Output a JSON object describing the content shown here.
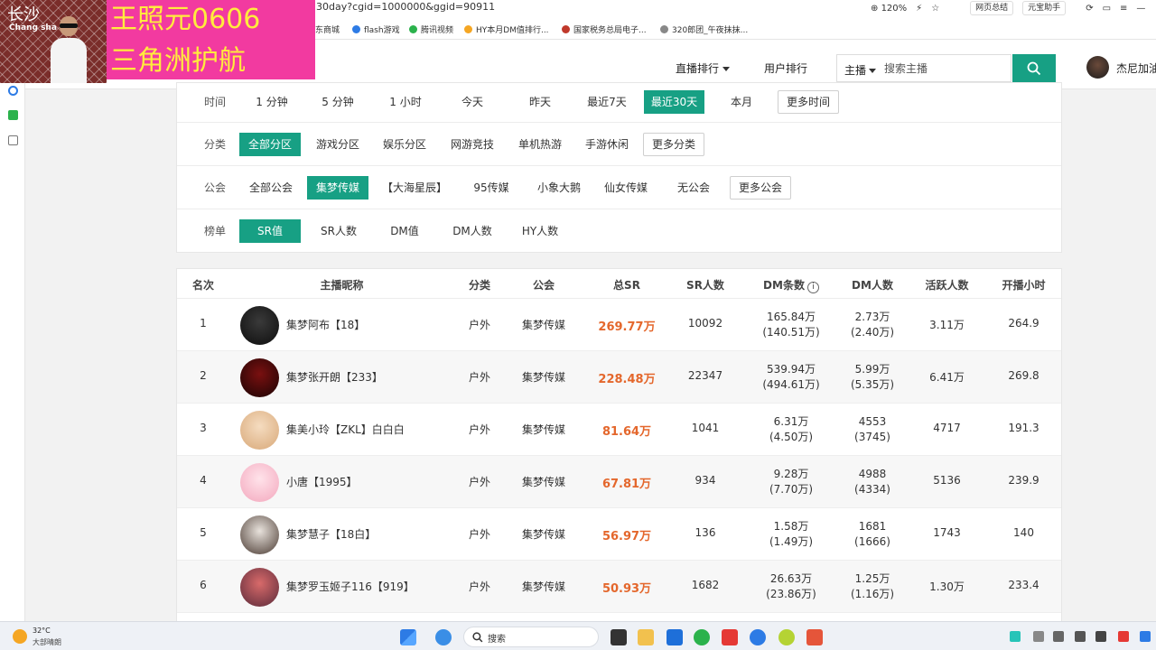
{
  "browser": {
    "url": "30day?cgid=1000000&ggid=90911",
    "zoom": "120%",
    "chips": [
      "网页总结",
      "元宝助手"
    ],
    "bookmarks": [
      "东商城",
      "flash游戏",
      "腾讯视频",
      "HY本月DM值排行...",
      "国家税务总局电子...",
      "320郎团_午夜抹抹..."
    ]
  },
  "overlay": {
    "cam_city": "长沙",
    "cam_sub": "Chang sha",
    "banner_line1": "王照元0606",
    "banner_line2": "三角洲护航"
  },
  "header": {
    "nav": [
      {
        "label": "直播排行",
        "active": true
      },
      {
        "label": "用户排行",
        "active": false
      }
    ],
    "search_type": "主播",
    "search_placeholder": "搜索主播",
    "user_name": "杰尼加油"
  },
  "filters": {
    "time": {
      "label": "时间",
      "options": [
        "1 分钟",
        "5 分钟",
        "1 小时",
        "今天",
        "昨天",
        "最近7天",
        "最近30天",
        "本月"
      ],
      "active": 6,
      "more": "更多时间"
    },
    "category": {
      "label": "分类",
      "options": [
        "全部分区",
        "游戏分区",
        "娱乐分区",
        "网游竞技",
        "单机热游",
        "手游休闲"
      ],
      "active": 0,
      "more": "更多分类"
    },
    "guild": {
      "label": "公会",
      "options": [
        "全部公会",
        "集梦传媒",
        "【大海星辰】",
        "95传媒",
        "小象大鹅",
        "仙女传媒",
        "无公会"
      ],
      "active": 1,
      "more": "更多公会"
    },
    "board": {
      "label": "榜单",
      "options": [
        "SR值",
        "SR人数",
        "DM值",
        "DM人数",
        "HY人数"
      ],
      "active": 0
    }
  },
  "table": {
    "headers": {
      "rank": "名次",
      "nickname": "主播昵称",
      "category": "分类",
      "guild": "公会",
      "total_sr": "总SR",
      "sr_people": "SR人数",
      "dm_count": "DM条数",
      "dm_people": "DM人数",
      "active_people": "活跃人数",
      "hours": "开播小时"
    },
    "rows": [
      {
        "rank": "1",
        "name": "集梦阿布【18】",
        "category": "户外",
        "guild": "集梦传媒",
        "total_sr": "269.77万",
        "sr_people": "10092",
        "dm_count": "165.84万",
        "dm_count_sub": "(140.51万)",
        "dm_people": "2.73万",
        "dm_people_sub": "(2.40万)",
        "active": "3.11万",
        "hours": "264.9",
        "avatar_colors": [
          "#3a3a3a",
          "#0d0d0d"
        ]
      },
      {
        "rank": "2",
        "name": "集梦张开朗【233】",
        "category": "户外",
        "guild": "集梦传媒",
        "total_sr": "228.48万",
        "sr_people": "22347",
        "dm_count": "539.94万",
        "dm_count_sub": "(494.61万)",
        "dm_people": "5.99万",
        "dm_people_sub": "(5.35万)",
        "active": "6.41万",
        "hours": "269.8",
        "avatar_colors": [
          "#7a1010",
          "#1a0404"
        ]
      },
      {
        "rank": "3",
        "name": "集美小玲【ZKL】白白白",
        "category": "户外",
        "guild": "集梦传媒",
        "total_sr": "81.64万",
        "sr_people": "1041",
        "dm_count": "6.31万",
        "dm_count_sub": "(4.50万)",
        "dm_people": "4553",
        "dm_people_sub": "(3745)",
        "active": "4717",
        "hours": "191.3",
        "avatar_colors": [
          "#f5dcc0",
          "#d8a878"
        ]
      },
      {
        "rank": "4",
        "name": "小唐【1995】",
        "category": "户外",
        "guild": "集梦传媒",
        "total_sr": "67.81万",
        "sr_people": "934",
        "dm_count": "9.28万",
        "dm_count_sub": "(7.70万)",
        "dm_people": "4988",
        "dm_people_sub": "(4334)",
        "active": "5136",
        "hours": "239.9",
        "avatar_colors": [
          "#ffe3ea",
          "#f3a7bd"
        ]
      },
      {
        "rank": "5",
        "name": "集梦慧子【18白】",
        "category": "户外",
        "guild": "集梦传媒",
        "total_sr": "56.97万",
        "sr_people": "136",
        "dm_count": "1.58万",
        "dm_count_sub": "(1.49万)",
        "dm_people": "1681",
        "dm_people_sub": "(1666)",
        "active": "1743",
        "hours": "140",
        "avatar_colors": [
          "#e8e2dc",
          "#4a3a32"
        ]
      },
      {
        "rank": "6",
        "name": "集梦罗玉姬子116【919】",
        "category": "户外",
        "guild": "集梦传媒",
        "total_sr": "50.93万",
        "sr_people": "1682",
        "dm_count": "26.63万",
        "dm_count_sub": "(23.86万)",
        "dm_people": "1.25万",
        "dm_people_sub": "(1.16万)",
        "active": "1.30万",
        "hours": "233.4",
        "avatar_colors": [
          "#d86a6a",
          "#5a2a3a"
        ]
      }
    ]
  },
  "taskbar": {
    "temp": "32°C",
    "weather": "大部晴朗",
    "search": "搜索"
  },
  "colors": {
    "accent": "#17a084",
    "sr_value": "#e4672c",
    "banner_bg": "#f23aa0",
    "banner_text": "#ffec3d"
  }
}
